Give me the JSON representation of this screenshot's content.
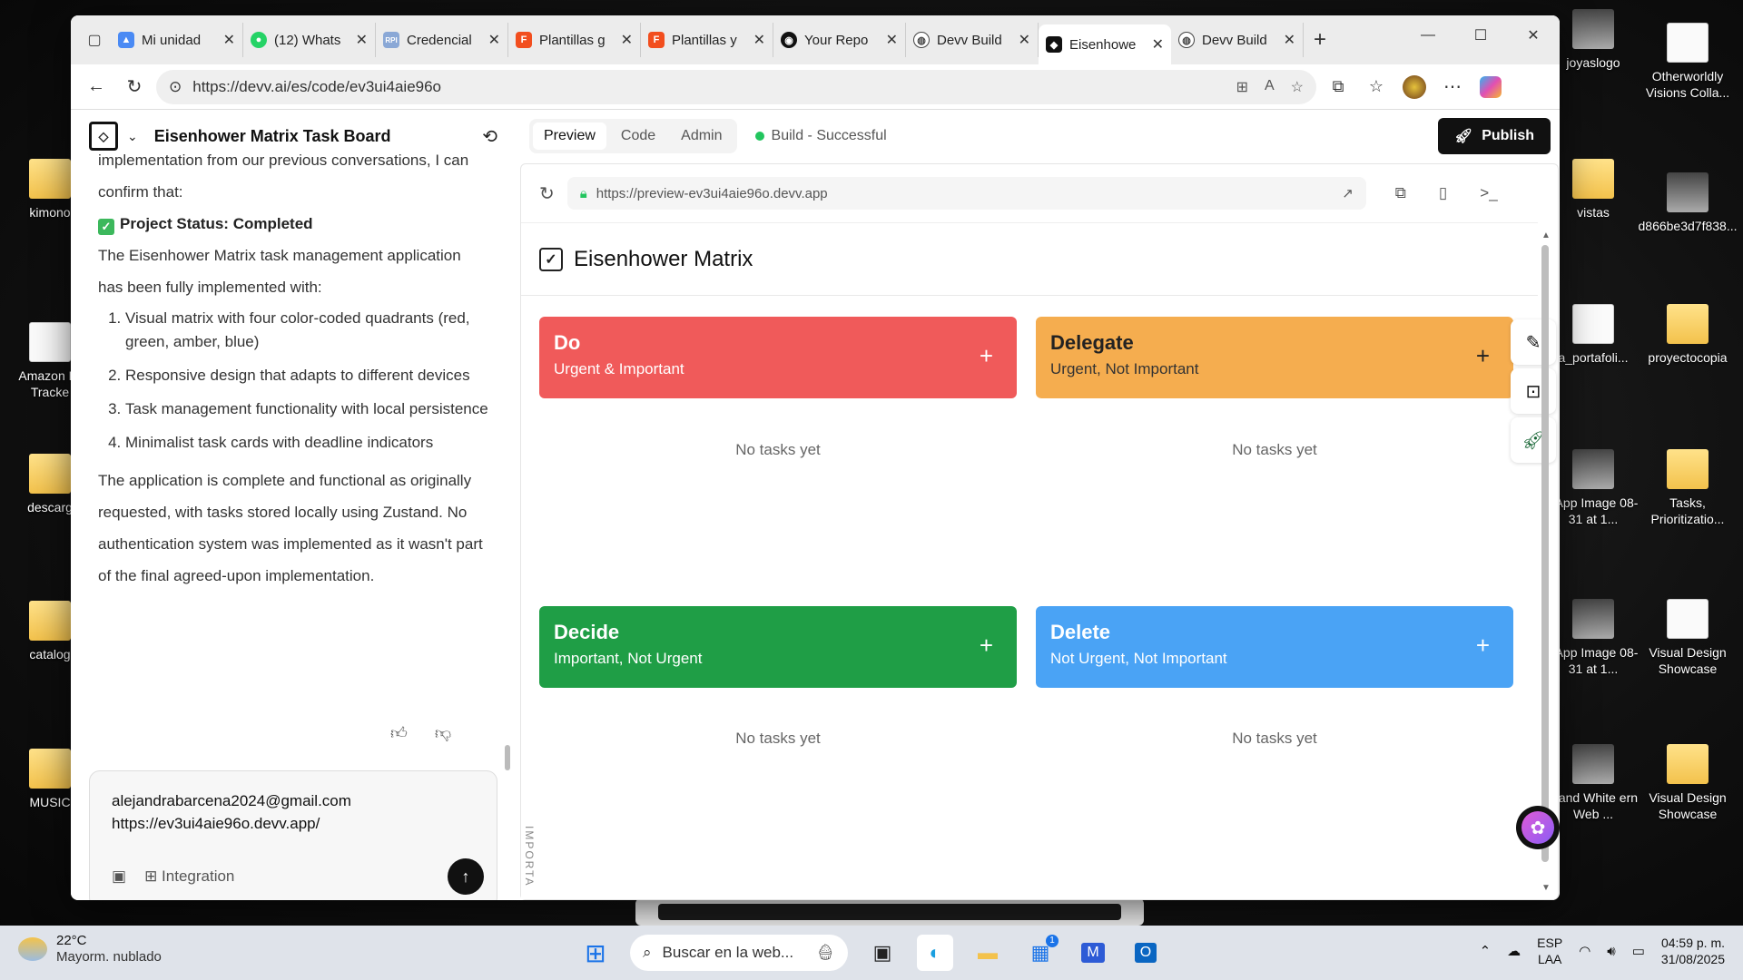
{
  "desktop": {
    "icons_left": [
      {
        "label": "kimono"
      },
      {
        "label": "Amazon Pr Tracke"
      },
      {
        "label": "descarg"
      },
      {
        "label": "catalog"
      },
      {
        "label": "MUSIC"
      }
    ],
    "icons_right": [
      {
        "label": "joyaslogo"
      },
      {
        "label": "Otherworldly Visions Colla..."
      },
      {
        "label": "vistas"
      },
      {
        "label": "d866be3d7f838..."
      },
      {
        "label": "a_portafoli..."
      },
      {
        "label": "proyectocopia"
      },
      {
        "label": "sApp Image 08-31 at 1..."
      },
      {
        "label": "Tasks, Prioritizatio..."
      },
      {
        "label": "sApp Image 08-31 at 1..."
      },
      {
        "label": "Visual Design Showcase"
      },
      {
        "label": "k and White ern Web ..."
      },
      {
        "label": "Visual Design Showcase"
      }
    ]
  },
  "browser": {
    "tabs": [
      {
        "label": "Mi unidad",
        "icon": "drive-icon",
        "color": "#4a8af4"
      },
      {
        "label": "(12) Whats",
        "icon": "whatsapp-icon",
        "color": "#25d366"
      },
      {
        "label": "Credencial",
        "icon": "rpi-icon",
        "color": "#8aa8d6"
      },
      {
        "label": "Plantillas g",
        "icon": "figma-icon",
        "color": "#f24e1e"
      },
      {
        "label": "Plantillas y",
        "icon": "figma-icon",
        "color": "#f24e1e"
      },
      {
        "label": "Your Repo",
        "icon": "github-icon",
        "color": "#111111"
      },
      {
        "label": "Devv Build",
        "icon": "globe-icon",
        "color": "#666666"
      },
      {
        "label": "Eisenhowe",
        "icon": "devv-icon",
        "color": "#111111"
      },
      {
        "label": "Devv Build",
        "icon": "globe-icon",
        "color": "#666666"
      }
    ],
    "url": "https://devv.ai/es/code/ev3ui4aie96o"
  },
  "chat": {
    "project_title": "Eisenhower Matrix Task Board",
    "intro": "implementation from our previous conversations, I can confirm that:",
    "status": "Project Status: Completed",
    "paragraph1": "The Eisenhower Matrix task management application has been fully implemented with:",
    "list": [
      "Visual matrix with four color-coded quadrants (red, green, amber, blue)",
      "Responsive design that adapts to different devices",
      "Task management functionality with local persistence",
      "Minimalist task cards with deadline indicators"
    ],
    "paragraph2": "The application is complete and functional as originally requested, with tasks stored locally using Zustand. No authentication system was implemented as it wasn't part of the final agreed-upon implementation.",
    "input_line1": "alejandrabarcena2024@gmail.com",
    "input_line2": "https://ev3ui4aie96o.devv.app/",
    "integration_label": "Integration"
  },
  "toolbar": {
    "tabs": [
      "Preview",
      "Code",
      "Admin"
    ],
    "build_status": "Build - Successful",
    "publish_label": "Publish"
  },
  "preview": {
    "url": "https://preview-ev3ui4aie96o.devv.app",
    "app_title": "Eisenhower Matrix",
    "side_label": "IMPORTA",
    "quadrants": [
      {
        "name": "Do",
        "subtitle": "Urgent & Important",
        "color": "#f05a5a",
        "empty": "No tasks yet"
      },
      {
        "name": "Delegate",
        "subtitle": "Urgent, Not Important",
        "color": "#f5ad4f",
        "empty": "No tasks yet"
      },
      {
        "name": "Decide",
        "subtitle": "Important, Not Urgent",
        "color": "#1f9e46",
        "empty": "No tasks yet"
      },
      {
        "name": "Delete",
        "subtitle": "Not Urgent, Not Important",
        "color": "#4aa3f5",
        "empty": "No tasks yet"
      }
    ]
  },
  "taskbar": {
    "temperature": "22°C",
    "weather": "Mayorm. nublado",
    "search_placeholder": "Buscar en la web...",
    "lang1": "ESP",
    "lang2": "LAA",
    "time": "04:59 p. m.",
    "date": "31/08/2025",
    "badge": "1"
  }
}
